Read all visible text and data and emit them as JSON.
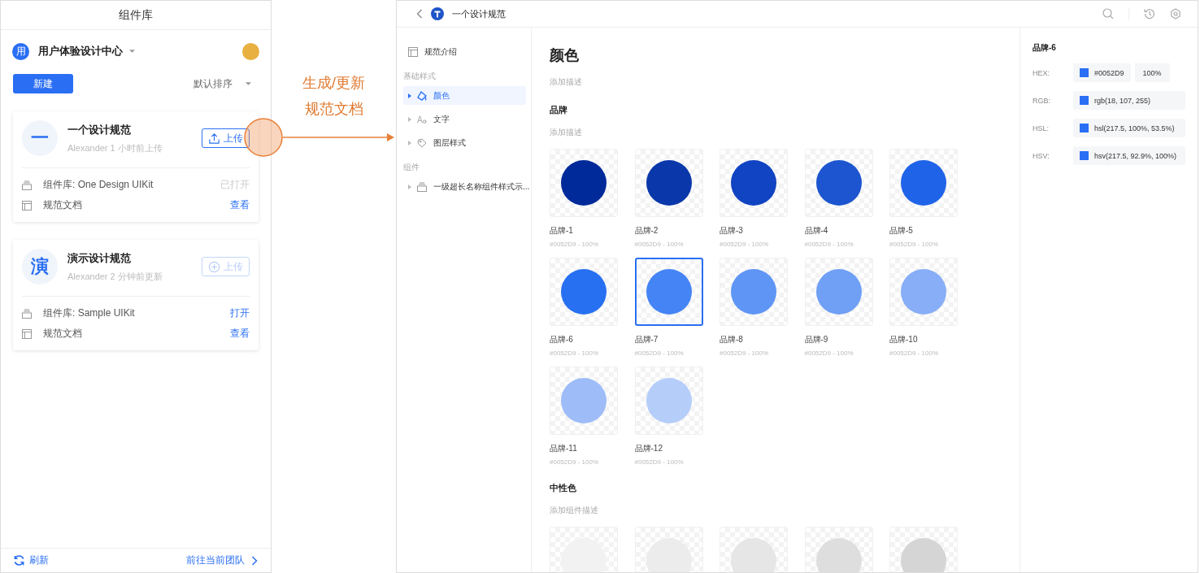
{
  "plugin_panel": {
    "title": "组件库",
    "team": {
      "initial": "用",
      "name": "用户体验设计中心"
    },
    "new_button": "新建",
    "sort": "默认排序",
    "projects": [
      {
        "initial": "一",
        "name": "一个设计规范",
        "meta": "Alexander 1 小时前上传",
        "upload": {
          "kind": "upload",
          "label": "上传",
          "disabled": false
        },
        "rows": [
          {
            "kind": "library",
            "label": "组件库: One Design UIKit",
            "action": "已打开",
            "action_disabled": true
          },
          {
            "kind": "doc",
            "label": "规范文档",
            "action": "查看",
            "action_disabled": false
          }
        ]
      },
      {
        "initial": "演",
        "name": "演示设计规范",
        "meta": "Alexander 2 分钟前更新",
        "upload": {
          "kind": "add",
          "label": "上传",
          "disabled": true
        },
        "rows": [
          {
            "kind": "library",
            "label": "组件库: Sample UIKit",
            "action": "打开",
            "action_disabled": false
          },
          {
            "kind": "doc",
            "label": "规范文档",
            "action": "查看",
            "action_disabled": false
          }
        ]
      }
    ],
    "footer": {
      "refresh": "刷新",
      "link": "前往当前团队"
    }
  },
  "annotation": {
    "lines": [
      "生成/更新",
      "规范文档"
    ]
  },
  "spec_window": {
    "title": "一个设计规范",
    "nav": [
      {
        "kind": "doc",
        "label": "规范介绍",
        "selected": false
      },
      {
        "kind": "heading",
        "label": "基础样式"
      },
      {
        "kind": "color",
        "label": "颜色",
        "selected": true
      },
      {
        "kind": "text",
        "label": "文字",
        "selected": false
      },
      {
        "kind": "layer",
        "label": "图层样式",
        "selected": false
      },
      {
        "kind": "heading",
        "label": "组件"
      },
      {
        "kind": "component",
        "label": "一级超长名称组件样式示...",
        "selected": false
      }
    ],
    "main": {
      "title": "颜色",
      "description": "添加描述",
      "sections": [
        {
          "title": "品牌",
          "description": "添加描述",
          "swatches": [
            {
              "name": "品牌-1",
              "value": "#0052D9 - 100%",
              "color": "#002a9a",
              "selected": false
            },
            {
              "name": "品牌-2",
              "value": "#0052D9 - 100%",
              "color": "#0a38ab",
              "selected": false
            },
            {
              "name": "品牌-3",
              "value": "#0052D9 - 100%",
              "color": "#1144c2",
              "selected": false
            },
            {
              "name": "品牌-4",
              "value": "#0052D9 - 100%",
              "color": "#1c55cf",
              "selected": false
            },
            {
              "name": "品牌-5",
              "value": "#0052D9 - 100%",
              "color": "#1f63e8",
              "selected": false
            },
            {
              "name": "品牌-6",
              "value": "#0052D9 - 100%",
              "color": "#2870f2",
              "selected": false
            },
            {
              "name": "品牌-7",
              "value": "#0052D9 - 100%",
              "color": "#4584f5",
              "selected": true
            },
            {
              "name": "品牌-8",
              "value": "#0052D9 - 100%",
              "color": "#5f95f5",
              "selected": false
            },
            {
              "name": "品牌-9",
              "value": "#0052D9 - 100%",
              "color": "#70a0f5",
              "selected": false
            },
            {
              "name": "品牌-10",
              "value": "#0052D9 - 100%",
              "color": "#88aef7",
              "selected": false
            },
            {
              "name": "品牌-11",
              "value": "#0052D9 - 100%",
              "color": "#9dbcf8",
              "selected": false
            },
            {
              "name": "品牌-12",
              "value": "#0052D9 - 100%",
              "color": "#b5cdf9",
              "selected": false
            }
          ]
        },
        {
          "title": "中性色",
          "description": "添加组件描述",
          "swatches": [
            {
              "color": "#f2f2f2",
              "selected": false
            },
            {
              "color": "#ececec",
              "selected": false
            },
            {
              "color": "#e6e6e6",
              "selected": false
            },
            {
              "color": "#dedede",
              "selected": false
            },
            {
              "color": "#d5d5d5",
              "selected": false
            }
          ]
        }
      ]
    },
    "inspector": {
      "title": "品牌-6",
      "fields": [
        {
          "label": "HEX:",
          "value": "#0052D9",
          "opacity": "100%"
        },
        {
          "label": "RGB:",
          "value": "rgb(18, 107, 255)"
        },
        {
          "label": "HSL:",
          "value": "hsl(217.5, 100%, 53.5%)"
        },
        {
          "label": "HSV:",
          "value": "hsv(217.5, 92.9%, 100%)"
        }
      ]
    }
  }
}
